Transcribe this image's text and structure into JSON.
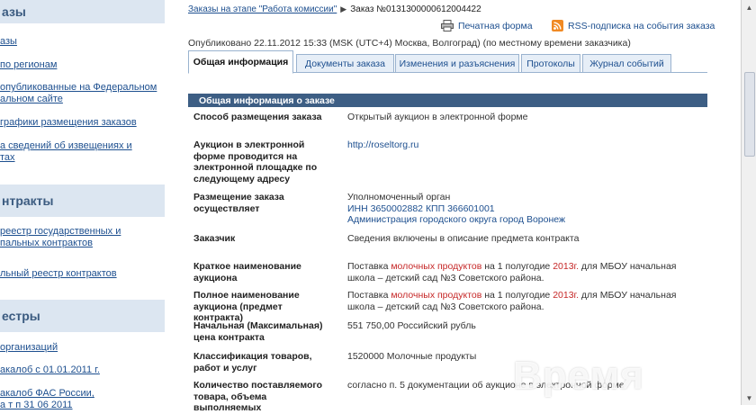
{
  "sidebar": {
    "sections": [
      {
        "title": "азы",
        "links": [
          "азы",
          "по регионам",
          "опубликованные на Федеральном",
          "альном сайте",
          "графики размещения заказов",
          "а сведений об извещениях и",
          "тах"
        ]
      },
      {
        "title": "нтракты",
        "links": [
          "реестр государственных и",
          "пальных контрактов",
          "льный реестр контрактов"
        ]
      },
      {
        "title": "естры",
        "links": [
          "организаций",
          "акалоб с 01.01.2011 г.",
          "акалоб ФАС России,",
          "а т    п     31 06 2011"
        ]
      }
    ]
  },
  "breadcrumb": {
    "link": "Заказы на этапе \"Работа комиссии\"",
    "separator": "▶",
    "current": "Заказ №0131300000612004422"
  },
  "actions": {
    "print": "Печатная форма",
    "rss": "RSS-подписка на события заказа"
  },
  "published": "Опубликовано 22.11.2012 15:33 (MSK (UTC+4) Москва, Волгоград) (по местному времени заказчика)",
  "tabs": [
    "Общая информация",
    "Документы заказа",
    "Изменения и разъяснения",
    "Протоколы",
    "Журнал событий"
  ],
  "active_tab": "Общая информация",
  "section_title": "Общая информация о заказе",
  "fields": [
    {
      "label": "Способ размещения заказа",
      "value": "Открытый аукцион в электронной форме"
    },
    {
      "label": "Аукцион в электронной форме проводится на электронной площадке по следующему адресу",
      "value": "http://roseltorg.ru"
    },
    {
      "label": "Размещение заказа осуществляет",
      "value_lines": [
        "Уполномоченный орган",
        "ИНН 3650002882 КПП 366601001",
        "Администрация городского округа город Воронеж"
      ]
    },
    {
      "label": "Заказчик",
      "value": "Сведения включены в описание предмета контракта"
    },
    {
      "label": "Краткое наименование аукциона",
      "value_parts": [
        "Поставка ",
        "молочных продуктов",
        " на 1 полугодие ",
        "2013г.",
        " для МБОУ начальная школа – детский сад №3 Советского района."
      ]
    },
    {
      "label": "Полное наименование аукциона (предмет контракта)",
      "value_parts": [
        "Поставка ",
        "молочных продуктов",
        " на 1 полугодие ",
        "2013г.",
        " для МБОУ начальная школа – детский сад №3 Советского района."
      ]
    },
    {
      "label": "Начальная (Максимальная) цена контракта",
      "value": "551 750,00 Российский рубль"
    },
    {
      "label": "Классификация товаров, работ и услуг",
      "value": "1520000 Молочные продукты"
    },
    {
      "label": "Количество поставляемого товара, объема выполняемых",
      "value": "согласно п. 5 документации об аукционе в электронной форме"
    }
  ],
  "watermark": "Время"
}
